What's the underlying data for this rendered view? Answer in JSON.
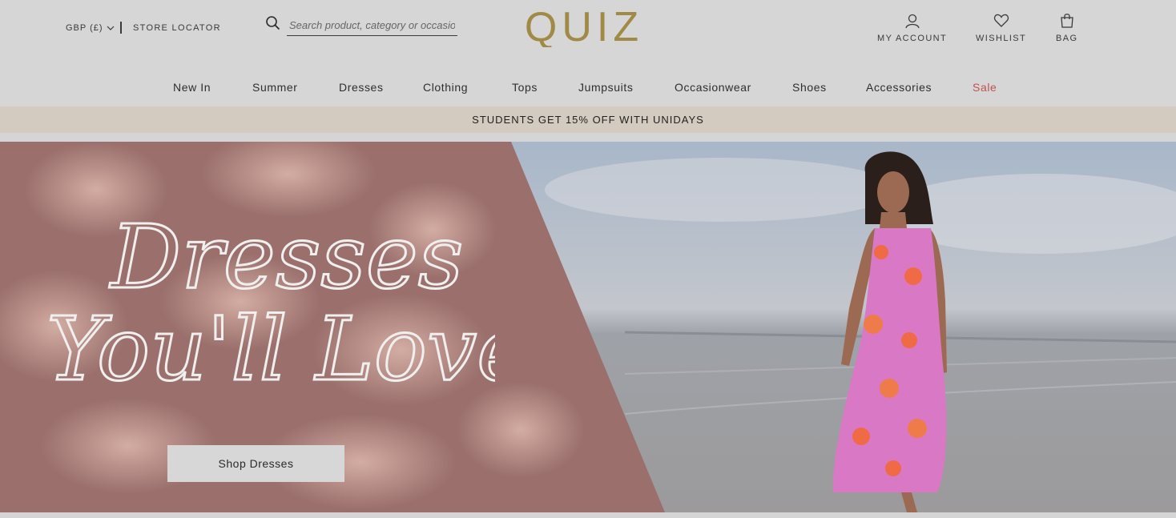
{
  "header": {
    "currency": "GBP (£)",
    "store_locator": "STORE LOCATOR",
    "search_placeholder": "Search product, category or occasion",
    "logo_text": "QUIZ",
    "account_label": "MY ACCOUNT",
    "wishlist_label": "WISHLIST",
    "bag_label": "BAG"
  },
  "nav": {
    "items": [
      "New In",
      "Summer",
      "Dresses",
      "Clothing",
      "Tops",
      "Jumpsuits",
      "Occasionwear",
      "Shoes",
      "Accessories",
      "Sale"
    ]
  },
  "promo": {
    "text": "STUDENTS GET 15% OFF WITH UNIDAYS"
  },
  "hero": {
    "headline_line1": "Dresses",
    "headline_line2": "You'll Love",
    "cta_label": "Shop Dresses"
  },
  "colors": {
    "brand_gold": "#a08a45",
    "sale_red": "#c0524f",
    "promo_bg": "#d4cbc0"
  },
  "icons": [
    "search-icon",
    "user-icon",
    "heart-icon",
    "bag-icon",
    "chevron-down-icon"
  ]
}
